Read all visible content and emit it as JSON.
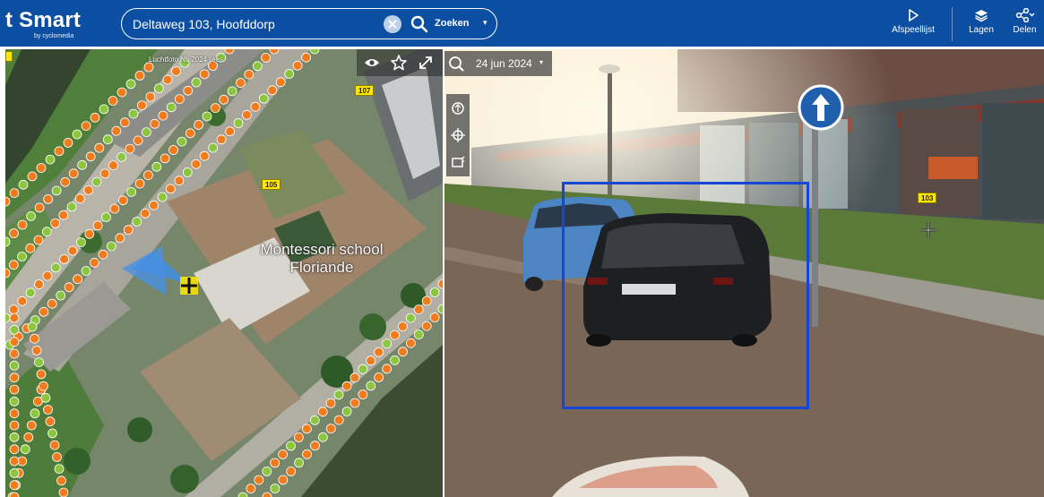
{
  "app": {
    "brand": "t Smart",
    "brand_sub": "by cyclomedia"
  },
  "search": {
    "value": "Deltaweg 103, Hoofddorp",
    "button_label": "Zoeken",
    "caret": "▾"
  },
  "header_actions": [
    {
      "label": "Afspeellijst",
      "icon": "play-icon"
    },
    {
      "label": "Lagen",
      "icon": "layers-icon"
    },
    {
      "label": "Delen",
      "icon": "share-icon"
    }
  ],
  "map": {
    "credit": "Luchtfoto NL 2024 (ees",
    "school_label": "Montessori school Floriande",
    "tags": [
      "107",
      "105"
    ],
    "tools": [
      "eye-icon",
      "star-icon",
      "expand-icon"
    ]
  },
  "streetview": {
    "date": "24 jun 2024",
    "caret": "▾",
    "tag": "103",
    "tools": [
      "compass-icon",
      "crosshair-icon",
      "camera-icon"
    ]
  },
  "colors": {
    "header": "#0b4ea2",
    "dot_orange": "#f07c1e",
    "dot_green": "#8cc63f",
    "detect_box": "#1646d6"
  }
}
